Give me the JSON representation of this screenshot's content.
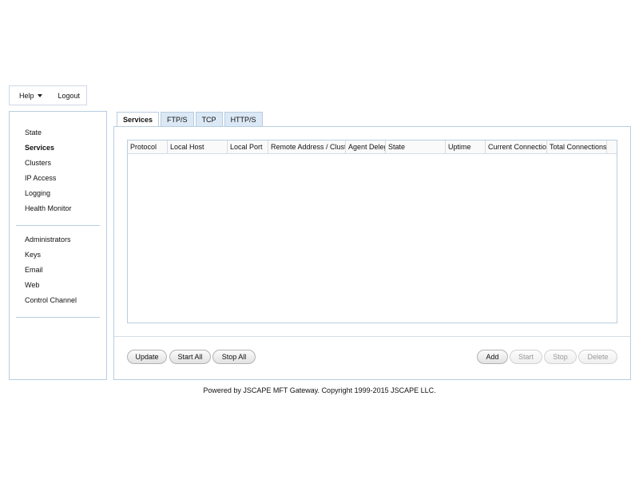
{
  "topbar": {
    "help_label": "Help",
    "logout_label": "Logout"
  },
  "sidebar": {
    "group1": [
      "State",
      "Services",
      "Clusters",
      "IP Access",
      "Logging",
      "Health Monitor"
    ],
    "group2": [
      "Administrators",
      "Keys",
      "Email",
      "Web",
      "Control Channel"
    ],
    "active": "Services"
  },
  "tabs": [
    "Services",
    "FTP/S",
    "TCP",
    "HTTP/S"
  ],
  "active_tab": "Services",
  "grid": {
    "columns": [
      "Protocol",
      "Local Host",
      "Local Port",
      "Remote Address / Cluster",
      "Agent Deleg",
      "State",
      "Uptime",
      "Current Connection",
      "Total Connections"
    ],
    "rows": []
  },
  "buttons": {
    "update": "Update",
    "start_all": "Start All",
    "stop_all": "Stop All",
    "add": "Add",
    "start": "Start",
    "stop": "Stop",
    "delete": "Delete"
  },
  "footer": "Powered by JSCAPE MFT Gateway. Copyright 1999-2015 JSCAPE LLC."
}
